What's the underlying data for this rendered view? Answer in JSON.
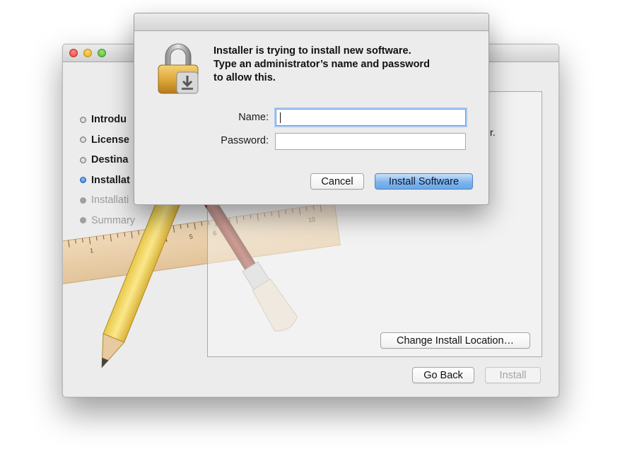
{
  "installer": {
    "steps": [
      {
        "label": "Introdu",
        "state": "done"
      },
      {
        "label": "License",
        "state": "done"
      },
      {
        "label": "Destina",
        "state": "done"
      },
      {
        "label": "Installat",
        "state": "current"
      },
      {
        "label": "Installati",
        "state": "pending"
      },
      {
        "label": "Summary",
        "state": "pending"
      }
    ],
    "content_text_fragment": "r.",
    "change_location_label": "Change Install Location…",
    "go_back_label": "Go Back",
    "install_label": "Install",
    "ruler_numbers": [
      "1",
      "4",
      "5",
      "6",
      "10"
    ]
  },
  "auth": {
    "message_lines": [
      "Installer is trying to install new software.",
      "Type an administrator’s name and password",
      "to allow this."
    ],
    "name_label": "Name:",
    "name_value": "",
    "password_label": "Password:",
    "password_value": "",
    "cancel_label": "Cancel",
    "install_software_label": "Install Software"
  },
  "colors": {
    "window_bg": "#ececec",
    "primary_button": "#6aa6e8",
    "focus_ring": "#a9c9f3",
    "close": "#e0443b",
    "minimize": "#e0a922",
    "zoom": "#4fb833"
  },
  "icons": {
    "lock": "lock-icon",
    "pencil": "pencil-icon",
    "brush": "brush-icon",
    "ruler": "ruler-icon"
  }
}
